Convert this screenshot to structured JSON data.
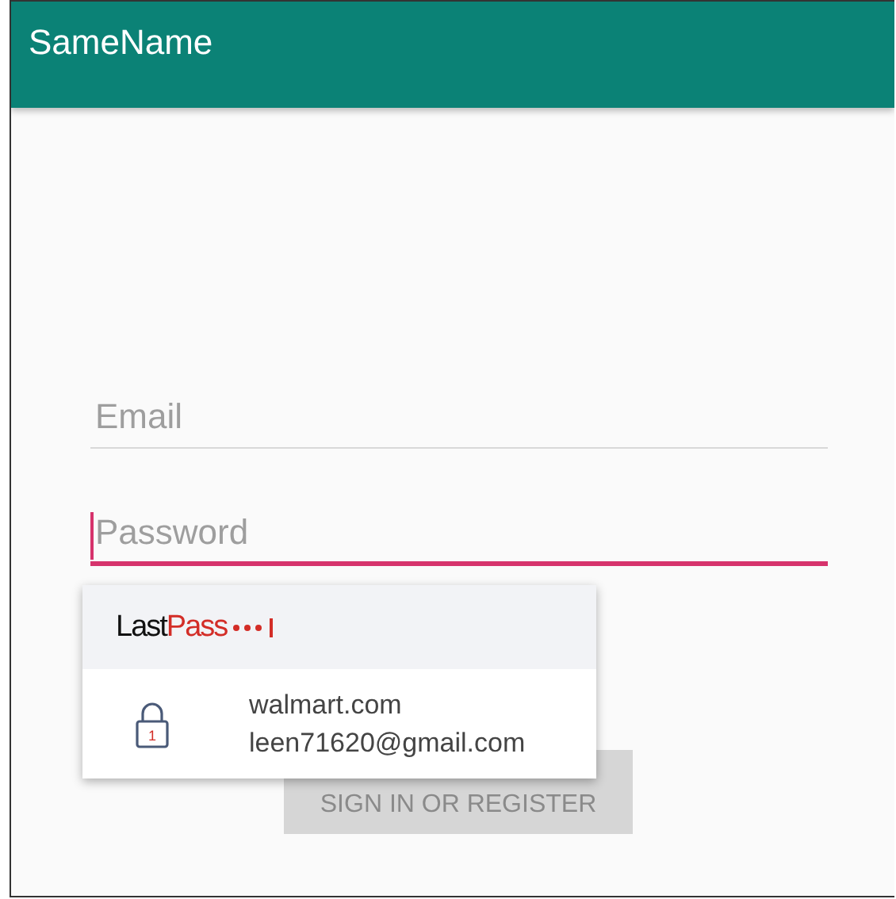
{
  "app_bar": {
    "title": "SameName"
  },
  "fields": [
    {
      "placeholder": "Email",
      "focused": false
    },
    {
      "placeholder": "Password",
      "focused": true
    }
  ],
  "autofill_popup": {
    "logo": {
      "dark": "Last",
      "accent": "Pass"
    },
    "items": [
      {
        "site": "walmart.com",
        "account": "leen71620@gmail.com",
        "badge": "1"
      }
    ]
  },
  "button": {
    "label": "SIGN IN OR REGISTER",
    "disabled": true
  }
}
